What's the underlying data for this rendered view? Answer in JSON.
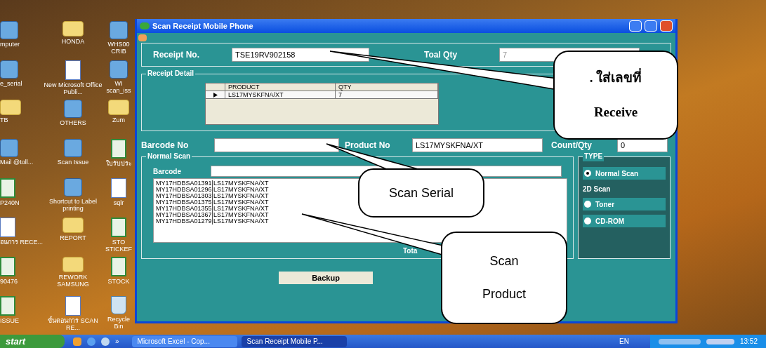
{
  "desktop": {
    "columns": [
      [
        {
          "label": "mputer",
          "kind": "app"
        },
        {
          "label": "e_serial",
          "kind": "app"
        },
        {
          "label": "TB",
          "kind": "folder"
        },
        {
          "label": "Mail @toll...",
          "kind": "app"
        },
        {
          "label": "P240N",
          "kind": "spreadsheet"
        },
        {
          "label": "อนการ RECE...",
          "kind": "document"
        },
        {
          "label": "90476",
          "kind": "spreadsheet"
        },
        {
          "label": "ISSUE",
          "kind": "spreadsheet"
        }
      ],
      [
        {
          "label": "HONDA",
          "kind": "folder"
        },
        {
          "label": "New Microsoft Office Publi...",
          "kind": "document"
        },
        {
          "label": "OTHERS",
          "kind": "app"
        },
        {
          "label": "Scan Issue",
          "kind": "app"
        },
        {
          "label": "Shortcut to Label printing",
          "kind": "app"
        },
        {
          "label": "REPORT",
          "kind": "folder"
        },
        {
          "label": "REWORK SAMSUNG",
          "kind": "folder"
        },
        {
          "label": "ขั้นตอนการ SCAN RE...",
          "kind": "document"
        }
      ],
      [
        {
          "label": "WHS00 CRIB",
          "kind": "app"
        },
        {
          "label": "WI scan_iss",
          "kind": "app"
        },
        {
          "label": "Zum",
          "kind": "folder"
        },
        {
          "label": "ใบรับประ",
          "kind": "spreadsheet"
        },
        {
          "label": "sqlr",
          "kind": "document"
        },
        {
          "label": "STO STICKEF",
          "kind": "spreadsheet"
        },
        {
          "label": "STOCK",
          "kind": "spreadsheet"
        },
        {
          "label": "Recycle Bin",
          "kind": "recycle"
        }
      ]
    ]
  },
  "window": {
    "title": "Scan Receipt Mobile Phone",
    "receipt_no": {
      "label": "Receipt No.",
      "value": "TSE19RV902158"
    },
    "total_qty": {
      "label": "Toal Qty",
      "value": "7",
      "disabled": true
    },
    "receipt_detail": {
      "title": "Receipt Detail",
      "columns": [
        "PRODUCT",
        "QTY"
      ],
      "rows": [
        {
          "product": "LS17MYSKFNA/XT",
          "qty": "7",
          "selected": true
        }
      ]
    },
    "barcode_no": {
      "label": "Barcode No"
    },
    "product_no": {
      "label": "Product No",
      "value": "LS17MYSKFNA/XT"
    },
    "count_qty": {
      "label": "Count/Qty",
      "value": "0"
    },
    "normal_scan": {
      "title": "Normal Scan",
      "barcode_label": "Barcode",
      "items": [
        "MY17HDBSA01391|LS17MYSKFNA/XT",
        "MY17HDBSA01296|LS17MYSKFNA/XT",
        "MY17HDBSA01303|LS17MYSKFNA/XT",
        "MY17HDBSA01375|LS17MYSKFNA/XT",
        "MY17HDBSA01355|LS17MYSKFNA/XT",
        "MY17HDBSA01367|LS17MYSKFNA/XT",
        "MY17HDBSA01279|LS17MYSKFNA/XT"
      ],
      "total_label": "Tota"
    },
    "type": {
      "title": "TYPE",
      "options": [
        {
          "kind": "radio",
          "label": "Normal Scan",
          "selected": true
        },
        {
          "kind": "heading",
          "label": "2D Scan"
        },
        {
          "kind": "radio",
          "label": "Toner",
          "selected": false
        },
        {
          "kind": "radio",
          "label": "CD-ROM",
          "selected": false
        }
      ]
    },
    "buttons": [
      "Backup"
    ]
  },
  "callouts": [
    {
      "lines": [
        ". ใส่เลขที่",
        "Receive"
      ]
    },
    {
      "lines": [
        "Scan Serial"
      ]
    },
    {
      "lines": [
        "Scan",
        "Product"
      ]
    }
  ],
  "taskbar": {
    "start": "start",
    "more": "»",
    "tasks": [
      {
        "label": "Microsoft Excel - Cop...",
        "selected": false
      },
      {
        "label": "Scan Receipt Mobile P...",
        "selected": true
      }
    ],
    "language": "EN",
    "clock": "13:52"
  }
}
